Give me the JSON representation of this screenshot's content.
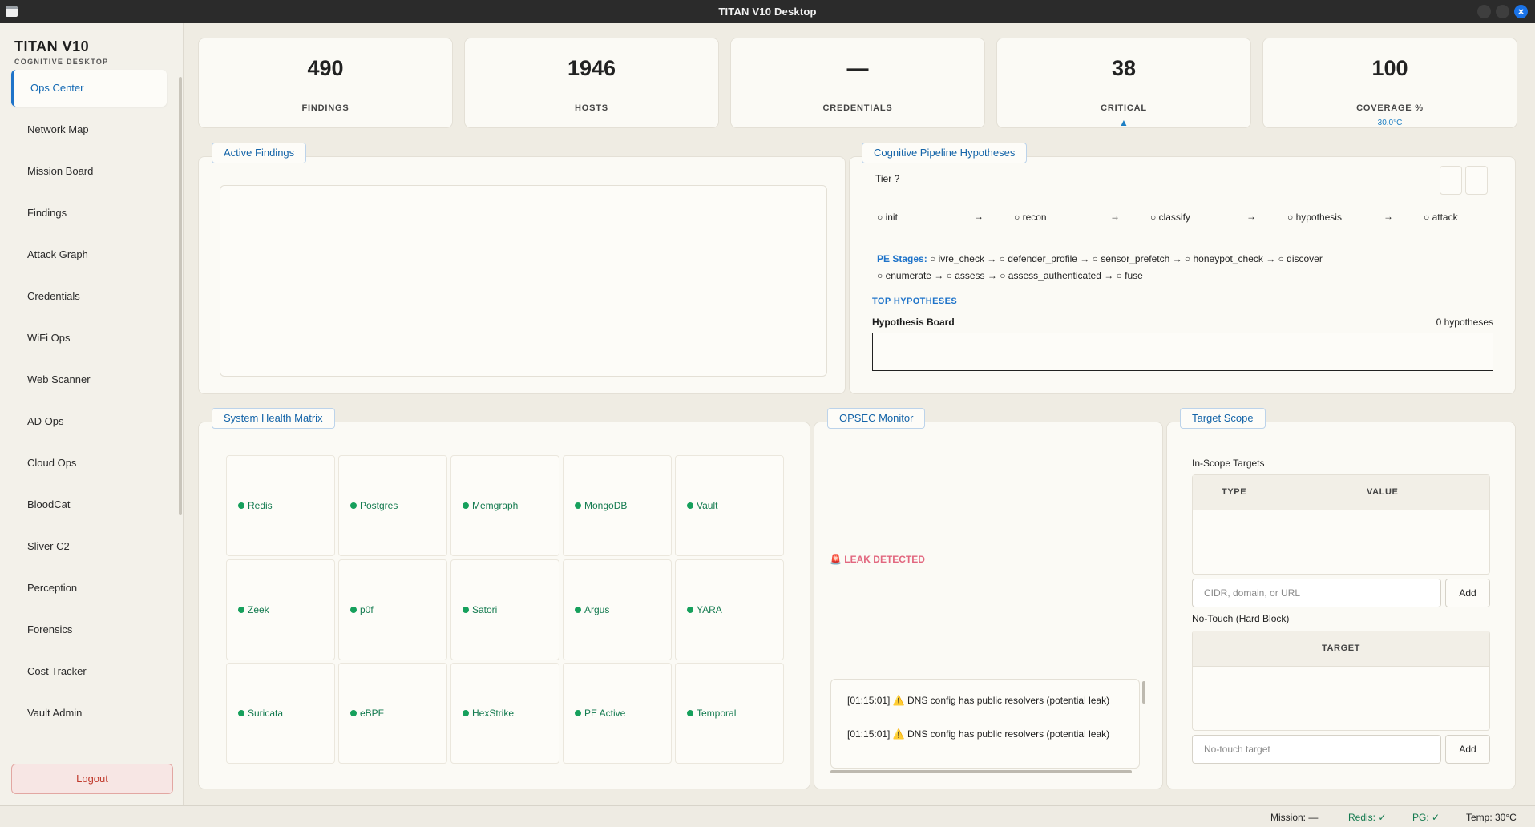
{
  "window": {
    "title": "TITAN V10 Desktop"
  },
  "brand": {
    "name": "TITAN V10",
    "subtitle": "COGNITIVE DESKTOP"
  },
  "nav": [
    {
      "label": "Ops Center",
      "active": true
    },
    {
      "label": "Network Map"
    },
    {
      "label": "Mission Board"
    },
    {
      "label": "Findings"
    },
    {
      "label": "Attack Graph"
    },
    {
      "label": "Credentials"
    },
    {
      "label": "WiFi Ops"
    },
    {
      "label": "Web Scanner"
    },
    {
      "label": "AD Ops"
    },
    {
      "label": "Cloud Ops"
    },
    {
      "label": "BloodCat"
    },
    {
      "label": "Sliver C2"
    },
    {
      "label": "Perception"
    },
    {
      "label": "Forensics"
    },
    {
      "label": "Cost Tracker"
    },
    {
      "label": "Vault Admin"
    }
  ],
  "logout_label": "Logout",
  "stats": [
    {
      "value": "490",
      "label": "FINDINGS",
      "sub": ""
    },
    {
      "value": "1946",
      "label": "HOSTS",
      "sub": ""
    },
    {
      "value": "—",
      "label": "CREDENTIALS",
      "sub": ""
    },
    {
      "value": "38",
      "label": "CRITICAL",
      "sub": "▲"
    },
    {
      "value": "100",
      "label": "COVERAGE %",
      "sub": "30.0°C"
    }
  ],
  "panels": {
    "findings": "Active Findings",
    "pipeline": "Cognitive Pipeline  Hypotheses",
    "health": "System Health Matrix",
    "opsec": "OPSEC Monitor",
    "scope": "Target Scope"
  },
  "pipeline": {
    "tier": "Tier ?",
    "stages": [
      "○ init",
      "○ recon",
      "○ classify",
      "○ hypothesis",
      "○ attack"
    ],
    "arrow": "→",
    "pe_label": "PE Stages:",
    "pe_line1": " ○ ivre_check → ○ defender_profile → ○ sensor_prefetch → ○ honeypot_check → ○ discover",
    "pe_line2": "○ enumerate → ○ assess → ○ assess_authenticated → ○ fuse",
    "top_label": "TOP HYPOTHESES",
    "board_title": "Hypothesis Board",
    "board_count": "0 hypotheses"
  },
  "health": [
    "Redis",
    "Postgres",
    "Memgraph",
    "MongoDB",
    "Vault",
    "Zeek",
    "p0f",
    "Satori",
    "Argus",
    "YARA",
    "Suricata",
    "eBPF",
    "HexStrike",
    "PE Active",
    "Temporal"
  ],
  "opsec": {
    "alert": "🚨 LEAK DETECTED",
    "logs": [
      "[01:15:01] ⚠️  DNS config has public resolvers (potential leak)",
      "[01:15:01] ⚠️  DNS config has public resolvers (potential leak)"
    ]
  },
  "scope": {
    "in_scope_label": "In-Scope Targets",
    "col_type": "TYPE",
    "col_value": "VALUE",
    "input_placeholder": "CIDR, domain, or URL",
    "add_label": "Add",
    "no_touch_label": "No-Touch (Hard Block)",
    "col_target": "TARGET",
    "no_touch_placeholder": "No-touch target",
    "add2_label": "Add"
  },
  "statusbar": {
    "mission": "Mission: —",
    "redis": "Redis: ✓",
    "pg": "PG: ✓",
    "temp": "Temp: 30°C"
  },
  "colors": {
    "accent": "#1e73c9",
    "ok": "#16a05c",
    "alert": "#e2677f",
    "danger": "#c0392b"
  }
}
